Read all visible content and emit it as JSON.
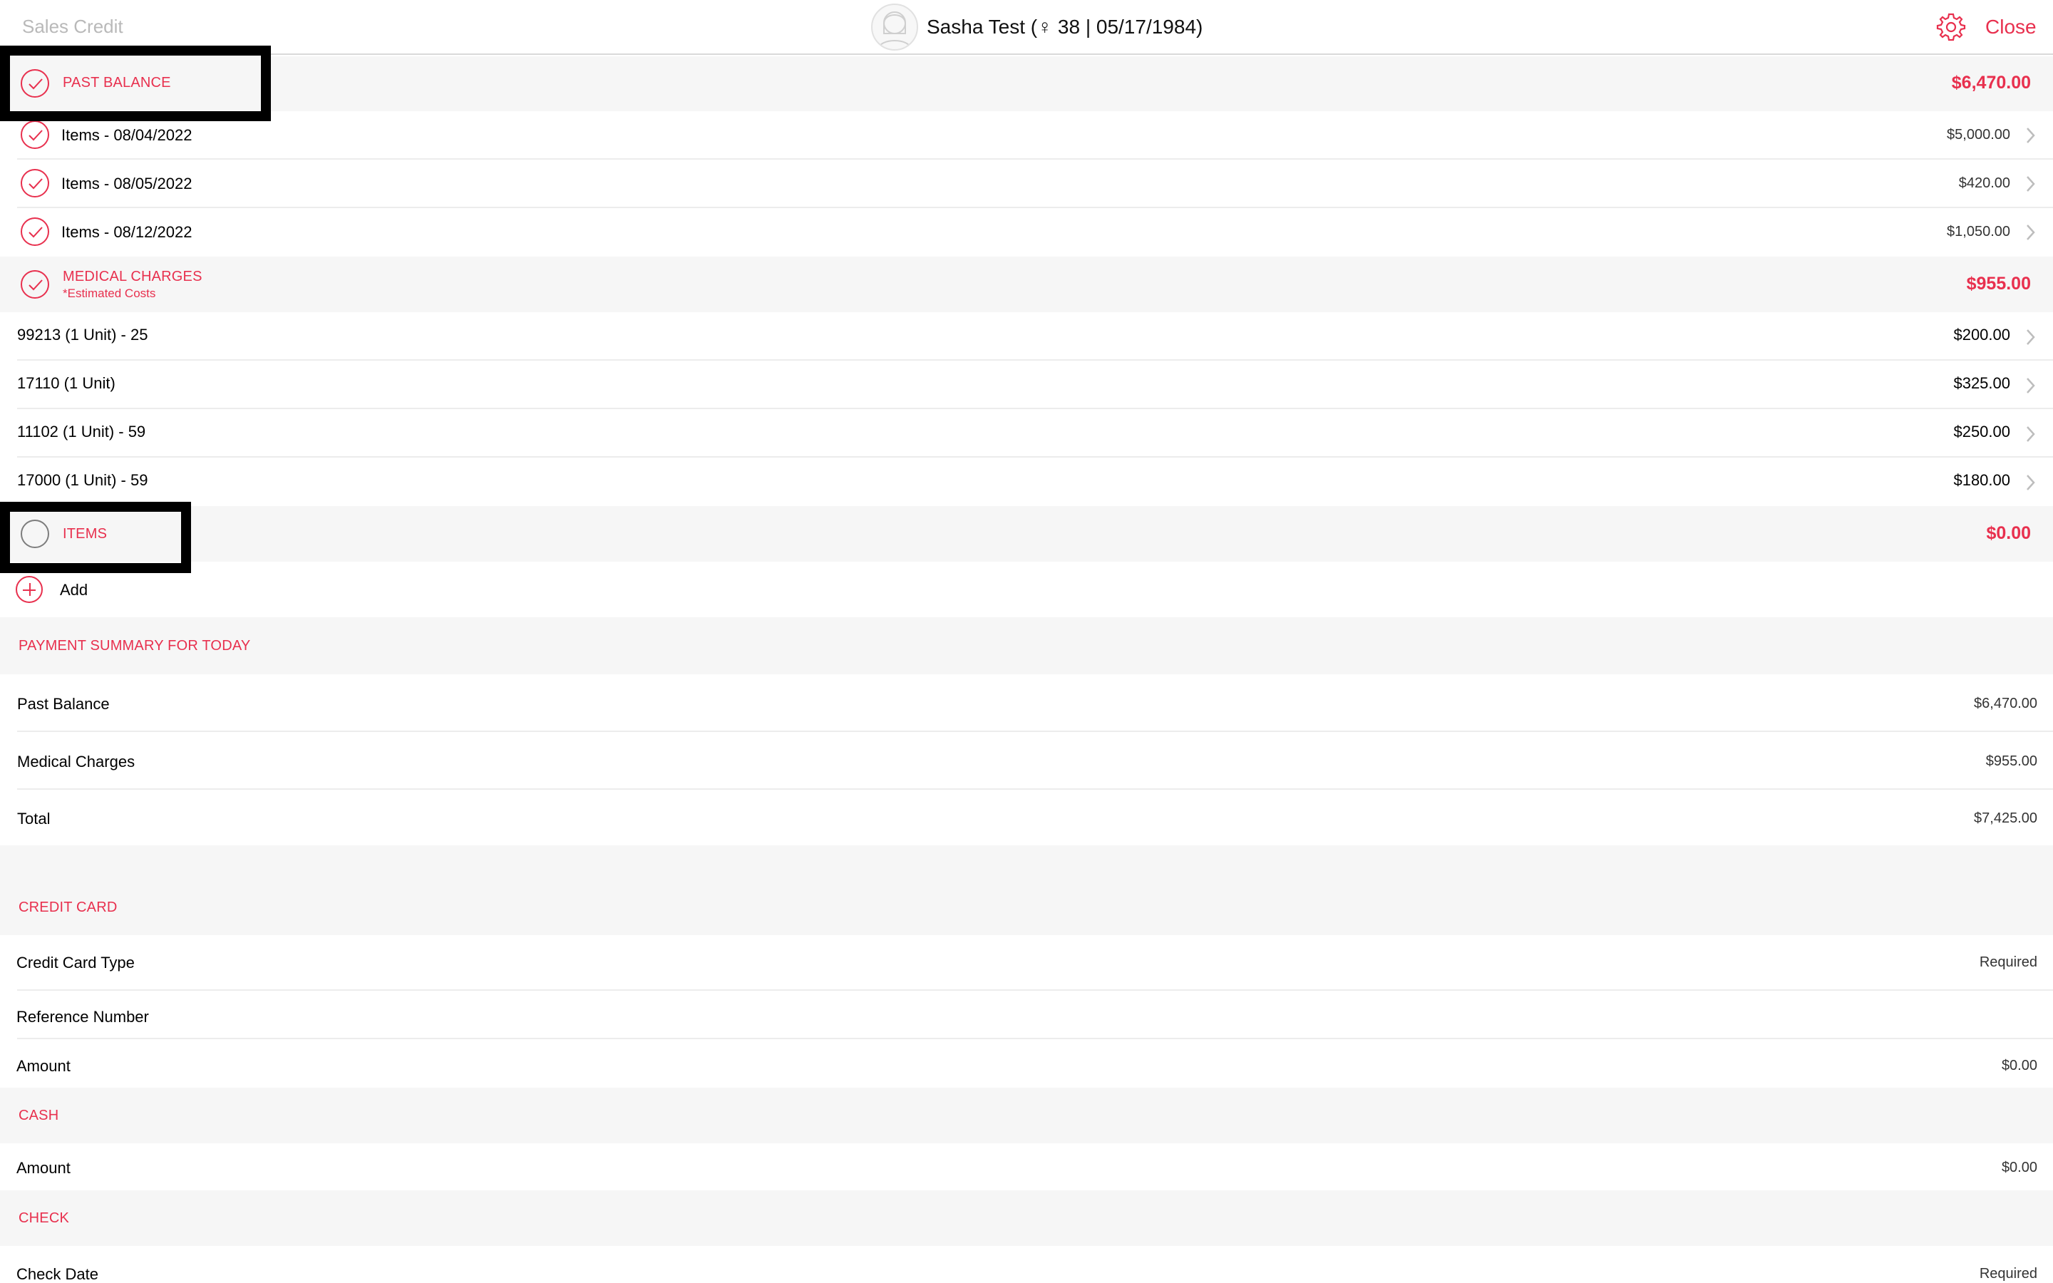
{
  "nav": {
    "title": "Sales Credit",
    "patient": "Sasha Test (♀ 38 | 05/17/1984)",
    "close": "Close"
  },
  "sections": {
    "past_balance": {
      "label": "PAST BALANCE",
      "total": "$6,470.00",
      "items": [
        {
          "label": "Items - 08/04/2022",
          "amount": "$5,000.00"
        },
        {
          "label": "Items - 08/05/2022",
          "amount": "$420.00"
        },
        {
          "label": "Items - 08/12/2022",
          "amount": "$1,050.00"
        }
      ]
    },
    "medical_charges": {
      "label": "MEDICAL CHARGES",
      "sublabel": "*Estimated Costs",
      "total": "$955.00",
      "items": [
        {
          "label": "99213 (1 Unit) - 25",
          "amount": "$200.00"
        },
        {
          "label": "17110 (1 Unit)",
          "amount": "$325.00"
        },
        {
          "label": "11102 (1 Unit) - 59",
          "amount": "$250.00"
        },
        {
          "label": "17000 (1 Unit) - 59",
          "amount": "$180.00"
        }
      ]
    },
    "items": {
      "label": "ITEMS",
      "total": "$0.00",
      "add": "Add"
    }
  },
  "summary": {
    "header": "PAYMENT SUMMARY FOR TODAY",
    "rows": [
      {
        "label": "Past Balance",
        "value": "$6,470.00"
      },
      {
        "label": "Medical Charges",
        "value": "$955.00"
      },
      {
        "label": "Total",
        "value": "$7,425.00"
      }
    ]
  },
  "credit_card": {
    "header": "CREDIT CARD",
    "type_label": "Credit Card Type",
    "type_value": "Required",
    "ref_label": "Reference Number",
    "amount_label": "Amount",
    "amount_value": "$0.00"
  },
  "cash": {
    "header": "CASH",
    "amount_label": "Amount",
    "amount_value": "$0.00"
  },
  "check": {
    "header": "CHECK",
    "date_label": "Check Date",
    "date_value": "Required"
  },
  "colors": {
    "accent": "#e8304e",
    "section_bg": "#f6f6f6",
    "nav_title": "#b9b9b9"
  },
  "icons": [
    "avatar-icon",
    "gear-icon",
    "checkmark-icon",
    "empty-circle-icon",
    "plus-circle-icon",
    "chevron-right-icon"
  ]
}
